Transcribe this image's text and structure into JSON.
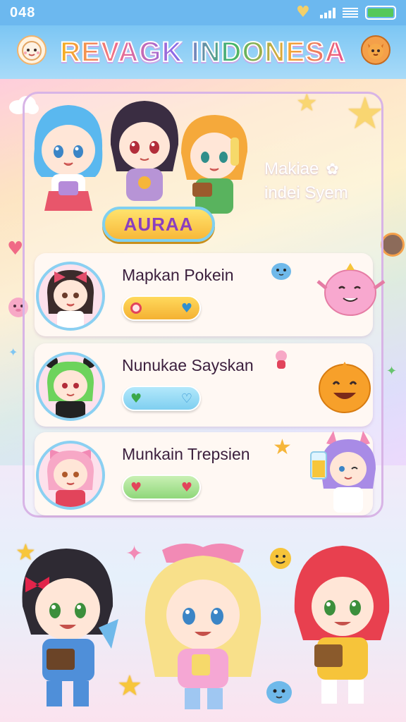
{
  "status_bar": {
    "time": "048",
    "icons": [
      "heart-badge-icon",
      "signal-icon",
      "wifi-icon",
      "battery-icon"
    ],
    "battery_color": "#55c85a"
  },
  "header": {
    "title": "REVAGK INDONESA",
    "left_mascot": "sheep-mascot-icon",
    "right_mascot": "cat-mascot-icon",
    "background": "#7cc6f4"
  },
  "hero": {
    "badge_label": "AURAA",
    "caption_line1": "Makiae",
    "caption_line2": "indei Syem"
  },
  "list": [
    {
      "name": "Mapkan Pokein",
      "pill_left_icon": "record-icon",
      "pill_right_icon": "heart-icon",
      "pill_color": "#f8c53a"
    },
    {
      "name": "Nunukae Sayskan",
      "pill_left_icon": "heart-icon",
      "pill_right_icon": "heart-icon",
      "pill_color": "#8fd7f3"
    },
    {
      "name": "Munkain Trepsien",
      "pill_left_icon": "heart-icon",
      "pill_right_icon": "heart-icon",
      "pill_color": "#9fe08c"
    }
  ],
  "colors": {
    "accent_purple": "#8a3fbf",
    "panel_border": "#d8b4e6",
    "avatar_ring": "#8ad0f2"
  }
}
